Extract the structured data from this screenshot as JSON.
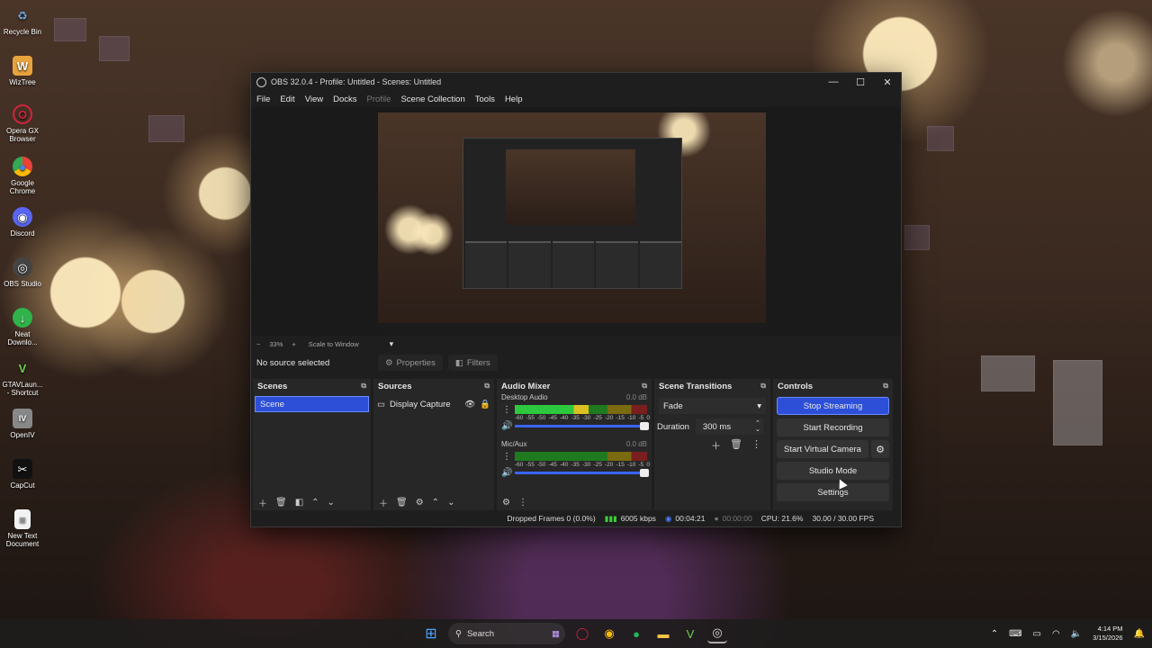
{
  "desktop": {
    "icons": [
      {
        "label": "Recycle Bin",
        "glyph": "♻",
        "color": "#6fa8dc"
      },
      {
        "label": "WizTree",
        "glyph": "W",
        "color": "#e8a33d"
      },
      {
        "label": "Opera GX Browser",
        "glyph": "O",
        "color": "#d0253b"
      },
      {
        "label": "Google Chrome",
        "glyph": "●",
        "color": "#34a853"
      },
      {
        "label": "Discord",
        "glyph": "◉",
        "color": "#5865f2"
      },
      {
        "label": "OBS Studio",
        "glyph": "◎",
        "color": "#444444"
      },
      {
        "label": "Neat Downlo...",
        "glyph": "↓",
        "color": "#2fb34a"
      },
      {
        "label": "GTAVLaun... - Shortcut",
        "glyph": "V",
        "color": "#3a7d2c"
      },
      {
        "label": "OpenIV",
        "glyph": "IV",
        "color": "#888888"
      },
      {
        "label": "CapCut",
        "glyph": "✂",
        "color": "#111111"
      },
      {
        "label": "New Text Document",
        "glyph": "≡",
        "color": "#f2f2f2"
      }
    ]
  },
  "window": {
    "title": "OBS 32.0.4 - Profile: Untitled - Scenes: Untitled",
    "minimize": "—",
    "maximize": "☐",
    "close": "✕",
    "menu": [
      "File",
      "Edit",
      "View",
      "Docks",
      "Profile",
      "Scene Collection",
      "Tools",
      "Help"
    ]
  },
  "preview_bar": {
    "minus": "−",
    "zoom": "33%",
    "plus": "+",
    "scale_mode": "Scale to Window",
    "dropdown": "▾"
  },
  "source_toolbar": {
    "no_source": "No source selected",
    "properties": "Properties",
    "filters": "Filters"
  },
  "scenes": {
    "title": "Scenes",
    "items": [
      "Scene"
    ]
  },
  "sources": {
    "title": "Sources",
    "items": [
      {
        "name": "Display Capture"
      }
    ]
  },
  "mixer": {
    "title": "Audio Mixer",
    "channels": [
      {
        "name": "Desktop Audio",
        "db": "0.0 dB",
        "level": 0.56
      },
      {
        "name": "Mic/Aux",
        "db": "0.0 dB",
        "level": 0.0
      }
    ],
    "ticks": [
      "-60",
      "-55",
      "-50",
      "-45",
      "-40",
      "-35",
      "-30",
      "-25",
      "-20",
      "-15",
      "-10",
      "-5",
      "0"
    ]
  },
  "transitions": {
    "title": "Scene Transitions",
    "selected": "Fade",
    "duration_label": "Duration",
    "duration_value": "300 ms"
  },
  "controls": {
    "title": "Controls",
    "stop_streaming": "Stop Streaming",
    "start_recording": "Start Recording",
    "start_virtual_camera": "Start Virtual Camera",
    "studio_mode": "Studio Mode",
    "settings": "Settings"
  },
  "status": {
    "dropped_frames": "Dropped Frames 0 (0.0%)",
    "bitrate": "6005 kbps",
    "stream_time": "00:04:21",
    "record_time": "00:00:00",
    "cpu": "CPU: 21.6%",
    "fps": "30.00 / 30.00 FPS"
  },
  "taskbar": {
    "search_label": "Search",
    "time": "4:14 PM",
    "date": "3/15/2026"
  },
  "colors": {
    "accent": "#2d4fd8",
    "window_bg": "#1e1e1e",
    "dock_bg": "#272727"
  }
}
